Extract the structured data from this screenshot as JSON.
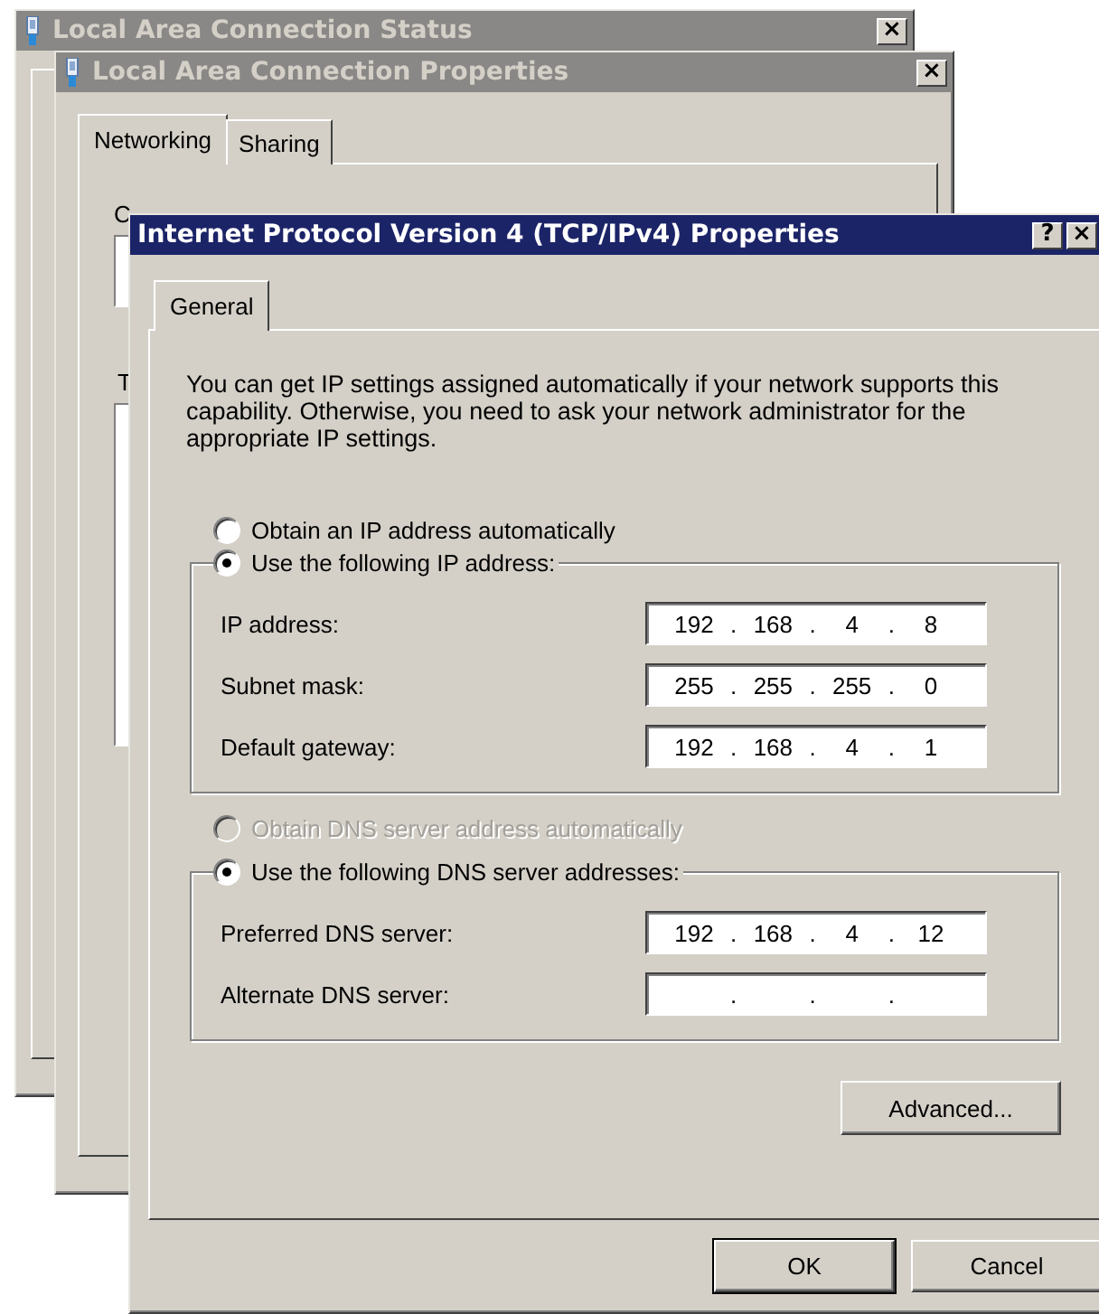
{
  "background_windows": [
    {
      "title": "Local Area Connection Status",
      "close": "×"
    },
    {
      "title": "Local Area Connection Properties",
      "close": "×",
      "tabs": [
        {
          "label": "Networking",
          "selected": true
        },
        {
          "label": "Sharing",
          "selected": false
        }
      ],
      "fragments": [
        "C",
        "T"
      ]
    }
  ],
  "dialog": {
    "title": "Internet Protocol Version 4 (TCP/IPv4) Properties",
    "title_buttons": [
      "?",
      "×"
    ],
    "tabs": [
      {
        "label": "General",
        "selected": true
      }
    ],
    "description": "You can get IP settings assigned automatically if your network supports this capability. Otherwise, you need to ask your network administrator for the appropriate IP settings.",
    "sections": [
      {
        "options": [
          {
            "label": "Obtain an IP address automatically",
            "selected": false,
            "disabled": false
          },
          {
            "label": "Use the following IP address:",
            "selected": true,
            "disabled": false
          }
        ],
        "fields": [
          {
            "label": "IP address:",
            "octets": [
              "192",
              "168",
              "4",
              "8"
            ]
          },
          {
            "label": "Subnet mask:",
            "octets": [
              "255",
              "255",
              "255",
              "0"
            ]
          },
          {
            "label": "Default gateway:",
            "octets": [
              "192",
              "168",
              "4",
              "1"
            ]
          }
        ]
      },
      {
        "options": [
          {
            "label": "Obtain DNS server address automatically",
            "selected": false,
            "disabled": true
          },
          {
            "label": "Use the following DNS server addresses:",
            "selected": true,
            "disabled": false
          }
        ],
        "fields": [
          {
            "label": "Preferred DNS server:",
            "octets": [
              "192",
              "168",
              "4",
              "12"
            ]
          },
          {
            "label": "Alternate DNS server:"
          }
        ]
      }
    ],
    "separator": ".",
    "advanced_button": "Advanced...",
    "buttons": [
      "OK",
      "Cancel"
    ]
  }
}
